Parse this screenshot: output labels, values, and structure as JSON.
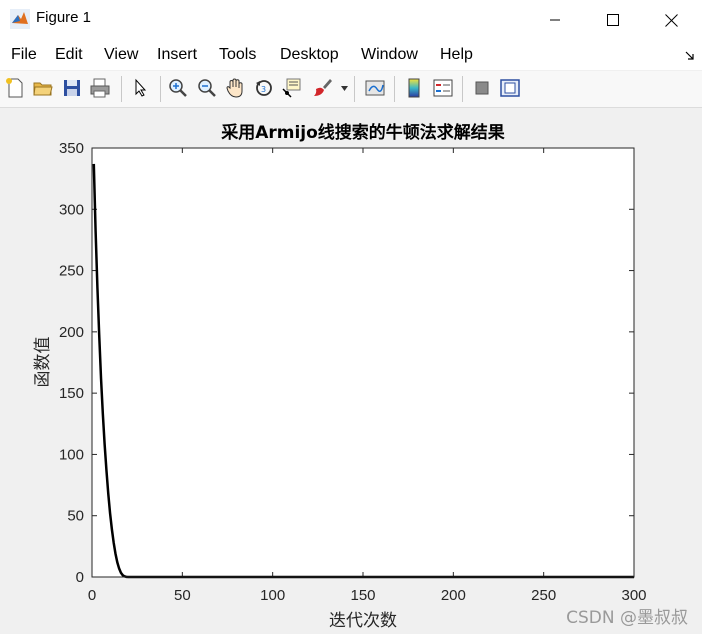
{
  "window": {
    "title": "Figure 1",
    "minimize_icon": "minimize-icon",
    "maximize_icon": "maximize-icon",
    "close_icon": "close-icon"
  },
  "menu": {
    "items": [
      "File",
      "Edit",
      "View",
      "Insert",
      "Tools",
      "Desktop",
      "Window",
      "Help"
    ]
  },
  "toolbar": {
    "icons": [
      "new-figure-icon",
      "open-file-icon",
      "save-icon",
      "print-icon",
      "select-arrow-icon",
      "zoom-in-icon",
      "zoom-out-icon",
      "pan-hand-icon",
      "rotate-3d-icon",
      "data-cursor-icon",
      "brush-icon",
      "brush-dropdown-icon",
      "link-plot-icon",
      "colorbar-icon",
      "legend-icon",
      "hide-plot-tools-icon",
      "show-plot-tools-icon"
    ]
  },
  "chart_data": {
    "type": "line",
    "title": "采用Armijo线搜索的牛顿法求解结果",
    "xlabel": "迭代次数",
    "ylabel": "函数值",
    "xlim": [
      0,
      300
    ],
    "ylim": [
      0,
      350
    ],
    "xticks": [
      0,
      50,
      100,
      150,
      200,
      250,
      300
    ],
    "yticks": [
      0,
      50,
      100,
      150,
      200,
      250,
      300,
      350
    ],
    "grid": false,
    "line_color": "#000000",
    "series": [
      {
        "x": [
          1,
          2,
          3,
          4,
          5,
          6,
          7,
          8,
          9,
          10,
          11,
          12,
          13,
          14,
          15,
          16,
          17,
          18,
          19,
          20,
          22,
          25,
          30,
          50,
          100,
          150,
          200,
          250,
          300
        ],
        "y": [
          337,
          282,
          236,
          197,
          162,
          133,
          108,
          87,
          68,
          52,
          39,
          28,
          19,
          12,
          7,
          3.5,
          1.5,
          0.5,
          0.1,
          0,
          0,
          0,
          0,
          0,
          0,
          0,
          0,
          0,
          0
        ]
      }
    ]
  },
  "watermark": "CSDN @墨叔叔"
}
